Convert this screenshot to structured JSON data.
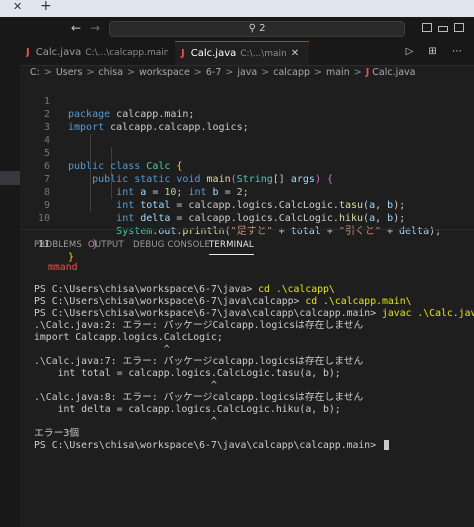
{
  "topbar": {
    "close_glyph": "✕",
    "new_tab_glyph": "+"
  },
  "title": {
    "back_glyph": "←",
    "forward_glyph": "→",
    "search_icon": "search-icon",
    "search_text": "⚲ 2"
  },
  "tabs": [
    {
      "icon": "J",
      "label": "Calc.java",
      "path": "C:\\...\\calcapp.main",
      "active": false
    },
    {
      "icon": "J",
      "label": "Calc.java",
      "path": "C:\\...\\main",
      "close": "✕",
      "active": true
    }
  ],
  "tab_actions": "▷ ⊞ ⋯",
  "breadcrumb": {
    "items": [
      "C:",
      "Users",
      "chisa",
      "workspace",
      "6-7",
      "java",
      "calcapp",
      "main"
    ],
    "separator": ">",
    "file_icon": "J",
    "file": "Calc.java"
  },
  "editor": {
    "line_numbers": [
      "1",
      "2",
      "3",
      "4",
      "5",
      "6",
      "7",
      "8",
      "9",
      "10",
      "11"
    ],
    "current_line": "11"
  },
  "panel": {
    "tabs": [
      "PROBLEMS",
      "OUTPUT",
      "DEBUG CONSOLE",
      "TERMINAL"
    ],
    "active_tab": "TERMINAL"
  },
  "terminal": {
    "lines": [
      "mmand",
      "",
      "PS C:\\Users\\chisa\\workspace\\6-7\\java> ",
      "PS C:\\Users\\chisa\\workspace\\6-7\\java\\calcapp> ",
      "PS C:\\Users\\chisa\\workspace\\6-7\\java\\calcapp\\calcapp.main> ",
      ".\\Calc.java:2: エラー: パッケージCalcapp.logicsは存在しません",
      "import Calcapp.logics.CalcLogic;",
      "                      ^",
      ".\\Calc.java:7: エラー: パッケージcalcapp.logicsは存在しません",
      "    int total = calcapp.logics.CalcLogic.tasu(a, b);",
      "                              ^",
      ".\\Calc.java:8: エラー: パッケージcalcapp.logicsは存在しません",
      "    int delta = calcapp.logics.CalcLogic.hiku(a, b);",
      "                              ^",
      "エラー3個",
      "PS C:\\Users\\chisa\\workspace\\6-7\\java\\calcapp\\calcapp.main> "
    ],
    "commands": {
      "2": "cd .\\calcapp\\",
      "3": "cd .\\calcapp.main\\",
      "4": "javac .\\Calc.java"
    }
  }
}
